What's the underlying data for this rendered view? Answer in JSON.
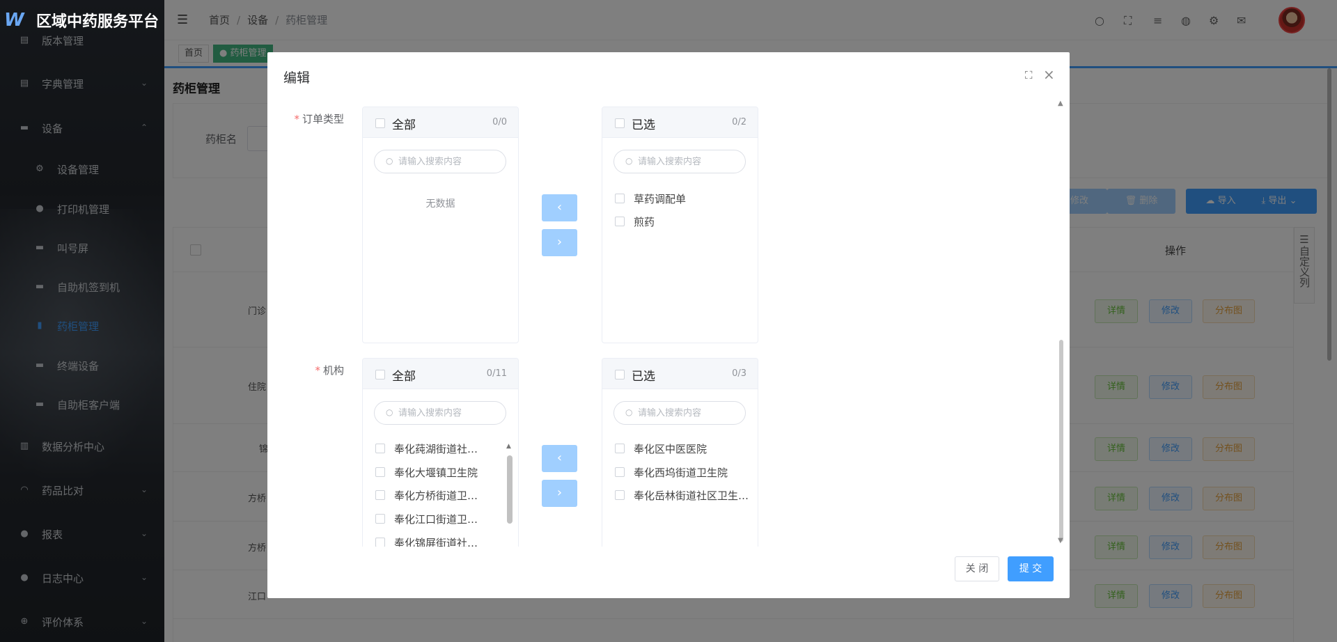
{
  "app": {
    "title": "区域中药服务平台"
  },
  "sidebar": {
    "items": [
      {
        "label": "版本管理",
        "icon": "doc-icon"
      },
      {
        "label": "字典管理",
        "icon": "list-icon"
      },
      {
        "label": "设备",
        "icon": "monitor-icon"
      },
      {
        "label": "设备管理",
        "icon": "gear-icon"
      },
      {
        "label": "打印机管理",
        "icon": "alert-icon"
      },
      {
        "label": "叫号屏",
        "icon": "monitor-icon"
      },
      {
        "label": "自助机签到机",
        "icon": "monitor-icon"
      },
      {
        "label": "药柜管理",
        "icon": "cabinet-icon"
      },
      {
        "label": "终端设备",
        "icon": "monitor-icon"
      },
      {
        "label": "自助柜客户端",
        "icon": "monitor-icon"
      },
      {
        "label": "数据分析中心",
        "icon": "chart-icon"
      },
      {
        "label": "药品比对",
        "icon": "headset-icon"
      },
      {
        "label": "报表",
        "icon": "user-icon"
      },
      {
        "label": "日志中心",
        "icon": "bulb-icon"
      },
      {
        "label": "评价体系",
        "icon": "plus-circle-icon"
      }
    ]
  },
  "header": {
    "breadcrumb": [
      "首页",
      "设备",
      "药柜管理"
    ]
  },
  "tags": [
    "首页",
    "药柜管理"
  ],
  "page": {
    "title": "药柜管理",
    "search_label": "药柜名",
    "toolbar": {
      "edit": "修改",
      "delete": "删除",
      "import": "导入",
      "export": "导出"
    },
    "table": {
      "op_header": "操作",
      "custom_columns": "自定义列",
      "row_prefixes": [
        "门诊",
        "住院",
        "锦",
        "方桥",
        "方桥",
        "江口"
      ],
      "row_actions": {
        "detail": "详情",
        "edit": "修改",
        "map": "分布图"
      }
    }
  },
  "dialog": {
    "title": "编辑",
    "fields": [
      {
        "label": "订单类型",
        "left": {
          "title": "全部",
          "count": "0/0",
          "placeholder": "请输入搜索内容",
          "empty": "无数据",
          "items": []
        },
        "right": {
          "title": "已选",
          "count": "0/2",
          "placeholder": "请输入搜索内容",
          "items": [
            "草药调配单",
            "煎药"
          ]
        }
      },
      {
        "label": "机构",
        "left": {
          "title": "全部",
          "count": "0/11",
          "placeholder": "请输入搜索内容",
          "items": [
            "奉化莼湖街道社区卫生服务中心",
            "奉化大堰镇卫生院",
            "奉化方桥街道卫生院",
            "奉化江口街道卫生院",
            "奉化锦屏街道社区卫生服务中心"
          ]
        },
        "right": {
          "title": "已选",
          "count": "0/3",
          "placeholder": "请输入搜索内容",
          "items": [
            "奉化区中医医院",
            "奉化西坞街道卫生院",
            "奉化岳林街道社区卫生服务中心"
          ]
        }
      }
    ],
    "transfer_left": "‹",
    "transfer_right": "›",
    "footer": {
      "cancel": "关 闭",
      "submit": "提 交"
    }
  },
  "colors": {
    "primary": "#409eff",
    "success": "#42b983",
    "disabled_blue": "#a0cfff"
  }
}
